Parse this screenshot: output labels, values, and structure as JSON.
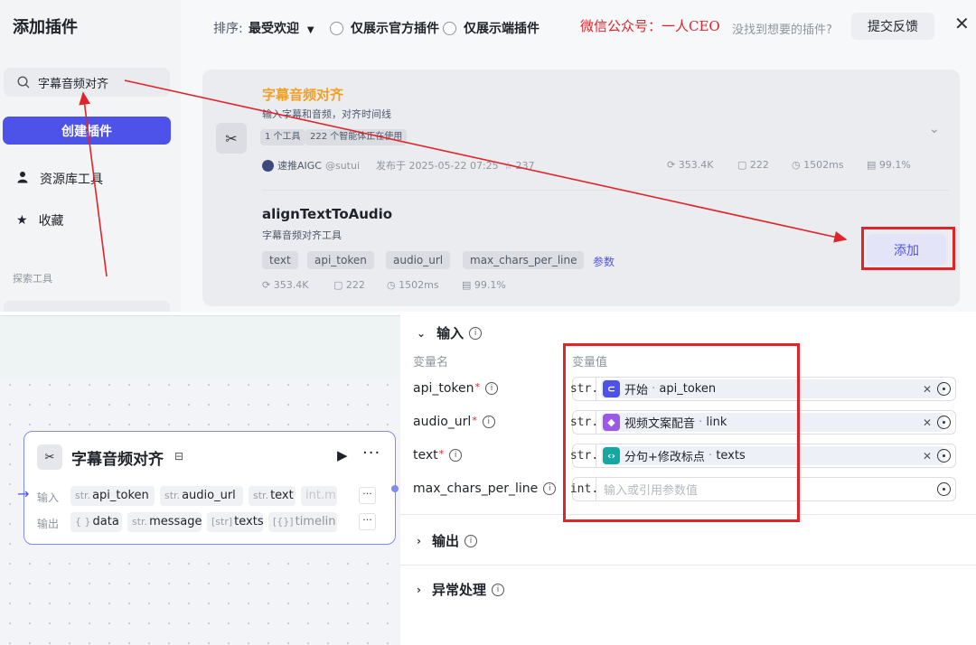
{
  "dialog": {
    "title": "添加插件",
    "search_value": "字幕音频对齐",
    "create_button": "创建插件",
    "nav": [
      {
        "label": "资源库工具",
        "icon": "user-icon"
      },
      {
        "label": "收藏",
        "icon": "star-icon"
      }
    ],
    "explore_label": "探索工具",
    "sort_label": "排序:",
    "sort_value": "最受欢迎",
    "filter_official": "仅展示官方插件",
    "filter_client": "仅展示端插件",
    "watermark": "微信公众号：一人CEO",
    "missing_text": "没找到想要的插件?",
    "feedback_button": "提交反馈"
  },
  "plugin": {
    "name": "字幕音频对齐",
    "description": "输入字幕和音频，对齐时间线",
    "tags": [
      "1 个工具",
      "222 个智能体正在使用"
    ],
    "author": "速推AIGC",
    "handle": "@sutui",
    "published": "发布于 2025-05-22 07:25",
    "favorites": "237",
    "stats": [
      "353.4K",
      "222",
      "1502ms",
      "99.1%"
    ]
  },
  "tool": {
    "name": "alignTextToAudio",
    "description": "字幕音频对齐工具",
    "params": [
      "text",
      "api_token",
      "audio_url",
      "max_chars_per_line"
    ],
    "params_link": "参数",
    "stats": [
      "353.4K",
      "222",
      "1502ms",
      "99.1%"
    ],
    "add_button": "添加"
  },
  "node": {
    "title": "字幕音频对齐",
    "input_label": "输入",
    "output_label": "输出",
    "inputs": [
      {
        "type": "str.",
        "name": "api_token"
      },
      {
        "type": "str.",
        "name": "audio_url"
      },
      {
        "type": "str.",
        "name": "text"
      },
      {
        "type": "int.",
        "name": "m"
      }
    ],
    "outputs": [
      {
        "type": "{ }",
        "name": "data"
      },
      {
        "type": "str.",
        "name": "message"
      },
      {
        "type": "[str]",
        "name": "texts"
      },
      {
        "type": "[{}]",
        "name": "timelin"
      }
    ]
  },
  "form": {
    "input_section": "输入",
    "col_name": "变量名",
    "col_value": "变量值",
    "rows": [
      {
        "name": "api_token",
        "required": "*",
        "type": "str.",
        "source": "开始",
        "field": "api_token",
        "icon_color": "#4d53e8"
      },
      {
        "name": "audio_url",
        "required": "*",
        "type": "str.",
        "source": "视频文案配音",
        "field": "link",
        "icon_color": "#9b59e8"
      },
      {
        "name": "text",
        "required": "*",
        "type": "str.",
        "source": "分句+修改标点",
        "field": "texts",
        "icon_color": "#14a8a0"
      },
      {
        "name": "max_chars_per_line",
        "required": "",
        "type": "int.",
        "placeholder": "输入或引用参数值"
      }
    ],
    "output_section": "输出",
    "error_section": "异常处理"
  },
  "colors": {
    "accent": "#4d53e8",
    "annotation_red": "#e0242a",
    "plugin_orange": "#f0a020"
  }
}
